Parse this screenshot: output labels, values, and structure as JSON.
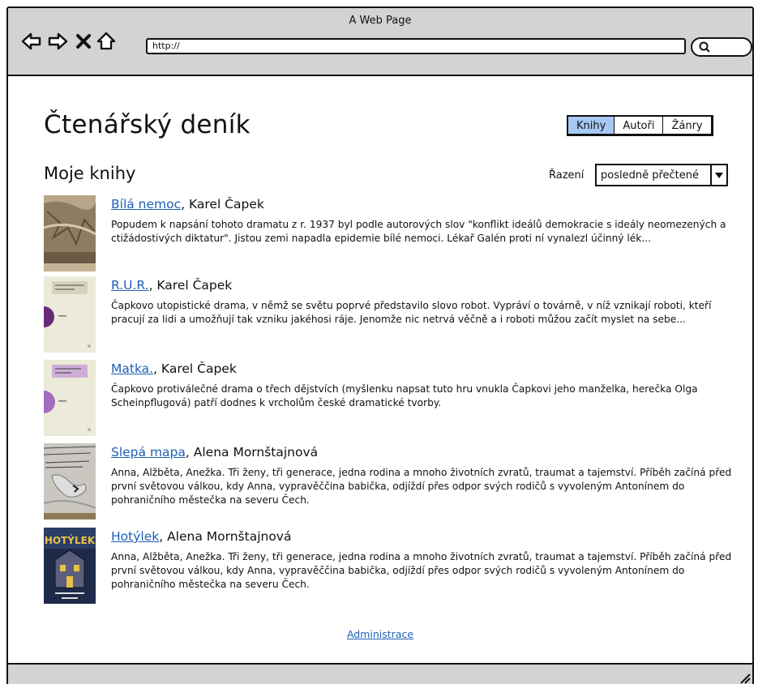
{
  "window": {
    "title": "A Web Page"
  },
  "toolbar": {
    "back_icon": "back-arrow-icon",
    "forward_icon": "forward-arrow-icon",
    "stop_icon": "close-x-icon",
    "home_icon": "home-icon",
    "address": "http://",
    "search_icon": "search-icon"
  },
  "page": {
    "title": "Čtenářský deník",
    "tabs": [
      {
        "label": "Knihy",
        "active": true
      },
      {
        "label": "Autoři",
        "active": false
      },
      {
        "label": "Žánry",
        "active": false
      }
    ],
    "section_title": "Moje knihy",
    "sort": {
      "label": "Řazení",
      "value": "posledně přečtené"
    },
    "books": [
      {
        "title": "Bílá nemoc",
        "author": ", Karel Čapek",
        "description": "Popudem k napsání tohoto dramatu z r. 1937 byl podle autorových slov \"konflikt ideálů demokracie s ideály neomezených a ctižádostivých diktatur\". Jistou zemi napadla epidemie bílé nemoci. Lékař Galén proti ní vynalezl účinný lék..."
      },
      {
        "title": "R.U.R.",
        "author": ", Karel Čapek",
        "description": "Čapkovo utopistické drama, v němž se světu poprvé představilo slovo robot. Vypráví o továrně, v níž vznikají roboti, kteří pracují za lidi a umožňují tak vzniku jakéhosi ráje. Jenomže nic netrvá věčně a i roboti můžou začít myslet na sebe..."
      },
      {
        "title": "Matka.",
        "author": ", Karel Čapek",
        "description": "Čapkovo protiválečné drama o třech dějstvích (myšlenku napsat tuto hru vnukla Čapkovi jeho manželka, herečka Olga Scheinpflugová) patří dodnes k vrcholům české dramatické tvorby."
      },
      {
        "title": "Slepá mapa",
        "author": ", Alena Mornštajnová",
        "description": "Anna, Alžběta, Anežka. Tři ženy, tři generace, jedna rodina a mnoho životních zvratů, traumat a tajemství. Příběh začíná před první světovou válkou, kdy Anna, vypravěččina babička, odjíždí přes odpor svých rodičů s vyvoleným Antonínem do pohraničního městečka na severu Čech."
      },
      {
        "title": "Hotýlek",
        "author": ", Alena Mornštajnová",
        "description": "Anna, Alžběta, Anežka. Tři ženy, tři generace, jedna rodina a mnoho životních zvratů, traumat a tajemství. Příběh začíná před první světovou válkou, kdy Anna, vypravěččina babička, odjíždí přes odpor svých rodičů s vyvoleným Antonínem do pohraničního městečka na severu Čech.",
        "cover_text": "HOTÝLEK"
      }
    ],
    "footer_link": "Administrace"
  },
  "colors": {
    "chrome": "#d3d3d3",
    "link": "#1f5fb5",
    "active_tab": "#a5c9f3"
  }
}
